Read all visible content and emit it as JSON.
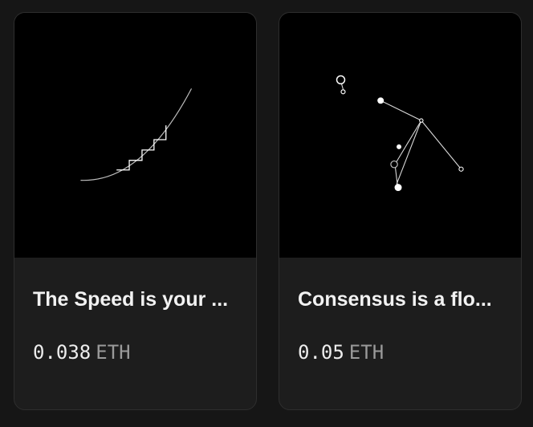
{
  "cards": [
    {
      "title": "The Speed is your ...",
      "price": "0.038",
      "currency": "ETH",
      "artwork_icon": "speed-curve-stairs-icon"
    },
    {
      "title": "Consensus is a flo...",
      "price": "0.05",
      "currency": "ETH",
      "artwork_icon": "constellation-nodes-icon"
    }
  ],
  "colors": {
    "page_background": "#161616",
    "card_background": "#1d1d1d",
    "art_background": "#000000",
    "title_text": "#f2f2f2",
    "currency_text": "#9a9a9a"
  }
}
